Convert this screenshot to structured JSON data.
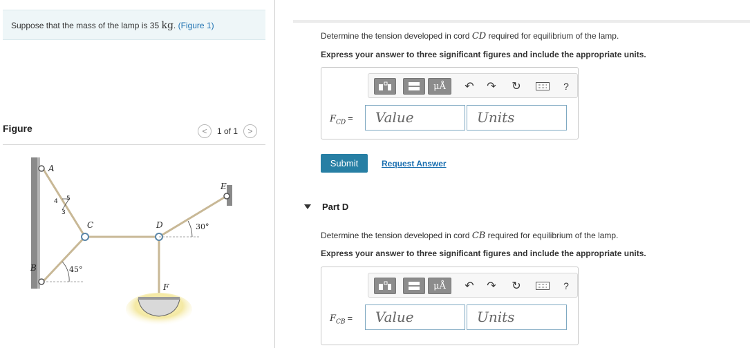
{
  "problem": {
    "prompt_text": "Suppose that the mass of the lamp is 35",
    "mass_unit": "kg",
    "figure_link": "(Figure 1)"
  },
  "figure": {
    "title": "Figure",
    "pager_text": "1 of 1",
    "prev_glyph": "<",
    "next_glyph": ">",
    "labels": {
      "A": "A",
      "B": "B",
      "C": "C",
      "D": "D",
      "E": "E",
      "F": "F",
      "slope_4": "4",
      "slope_5": "5",
      "slope_3": "3",
      "angle_30": "30°",
      "angle_45": "45°"
    }
  },
  "partC": {
    "question_prefix": "Determine the tension developed in cord",
    "cord": "CD",
    "question_suffix": "required for equilibrium of the lamp.",
    "instruction": "Express your answer to three significant figures and include the appropriate units.",
    "var_main": "F",
    "var_sub": "CD",
    "equals": "=",
    "value_placeholder": "Value",
    "units_placeholder": "Units",
    "submit_label": "Submit",
    "request_label": "Request Answer"
  },
  "partD": {
    "title": "Part D",
    "question_prefix": "Determine the tension developed in cord",
    "cord": "CB",
    "question_suffix": "required for equilibrium of the lamp.",
    "instruction": "Express your answer to three significant figures and include the appropriate units.",
    "var_main": "F",
    "var_sub": "CB",
    "equals": "=",
    "value_placeholder": "Value",
    "units_placeholder": "Units"
  },
  "toolbar": {
    "mu_label": "μÅ",
    "undo_glyph": "↶",
    "redo_glyph": "↷",
    "reset_glyph": "↻",
    "help_glyph": "?",
    "icons": [
      "templates-icon",
      "symbols-icon",
      "undo-icon",
      "redo-icon",
      "reset-icon",
      "keyboard-icon",
      "help-icon"
    ]
  },
  "colors": {
    "accent": "#277fa4",
    "link": "#1a6fb0",
    "prompt_bg": "#eef6f8",
    "toolbar_button": "#8c8c8c"
  }
}
